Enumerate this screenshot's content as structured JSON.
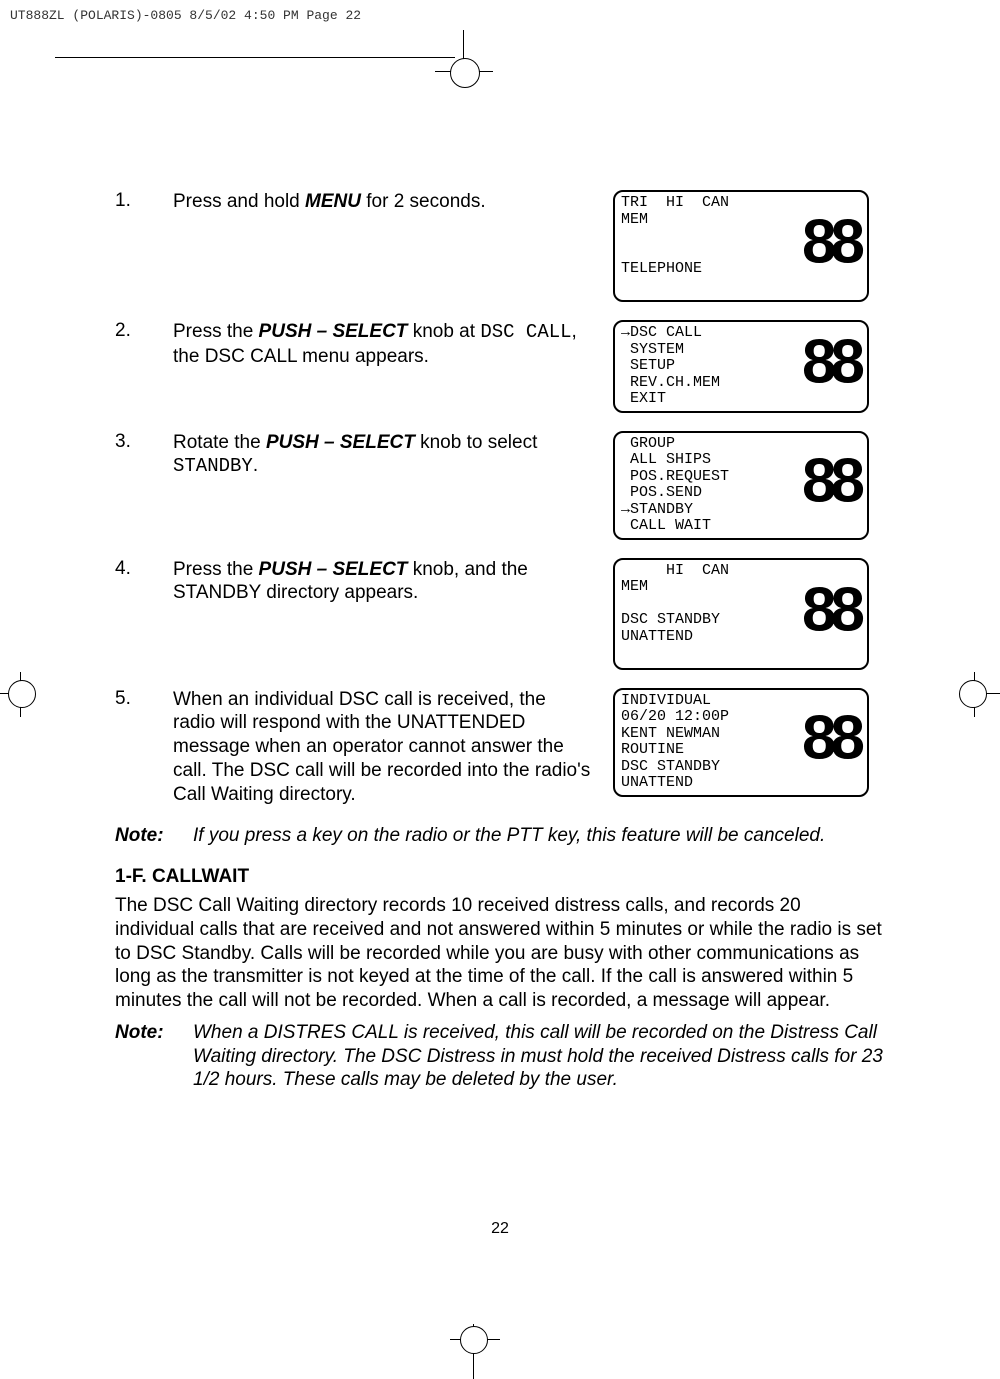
{
  "header": {
    "text": "UT888ZL (POLARIS)-0805  8/5/02  4:50 PM  Page 22"
  },
  "steps": [
    {
      "num": "1.",
      "pre": "Press and hold ",
      "bold": "MENU",
      "post": " for 2 seconds.",
      "lcd": "TRI  HI  CAN\nMEM\n\n\nTELEPHONE"
    },
    {
      "num": "2.",
      "pre": "Press the ",
      "bold": "PUSH – SELECT",
      "post": " knob at ",
      "mono": "DSC CALL",
      "tail": ", the DSC CALL menu appears.",
      "lcd": "→DSC CALL\n SYSTEM\n SETUP\n REV.CH.MEM\n EXIT"
    },
    {
      "num": "3.",
      "pre": "Rotate the ",
      "bold": "PUSH – SELECT",
      "post": " knob to select ",
      "mono": "STANDBY",
      "tail": ".",
      "lcd": " GROUP\n ALL SHIPS\n POS.REQUEST\n POS.SEND\n→STANDBY\n CALL WAIT"
    },
    {
      "num": "4.",
      "pre": "Press the ",
      "bold": "PUSH – SELECT",
      "post": " knob, and the STANDBY directory appears.",
      "lcd": "     HI  CAN\nMEM\n\nDSC STANDBY\nUNATTEND"
    },
    {
      "num": "5.",
      "text": "When an individual DSC call is received, the radio will respond with the UNATTENDED message when an operator cannot answer the call. The DSC call will be recorded into the radio's Call Waiting directory.",
      "lcd": "INDIVIDUAL\n06/20 12:00P\nKENT NEWMAN\nROUTINE\nDSC STANDBY\nUNATTEND"
    }
  ],
  "note1": {
    "label": "Note:",
    "text": "If you press a key on the radio or the PTT key, this feature will be canceled."
  },
  "section": {
    "title": "1-F. CALLWAIT",
    "para": "The DSC Call Waiting directory records 10 received distress calls, and records 20 individual calls that are received and not answered within 5 minutes or while the radio is set to DSC Standby. Calls will be recorded while you are busy with other communications as long as the transmitter is not keyed at the time of the call. If the call is answered within 5 minutes the call will not be recorded. When a call is recorded, a message will appear."
  },
  "note2": {
    "label": "Note:",
    "text": "When a DISTRES CALL is received, this call will be recorded on the Distress Call Waiting directory.  The DSC Distress in must hold the received Distress calls for 23 1/2 hours. These calls may be deleted by the user."
  },
  "pagenum": "22",
  "big88": "88"
}
